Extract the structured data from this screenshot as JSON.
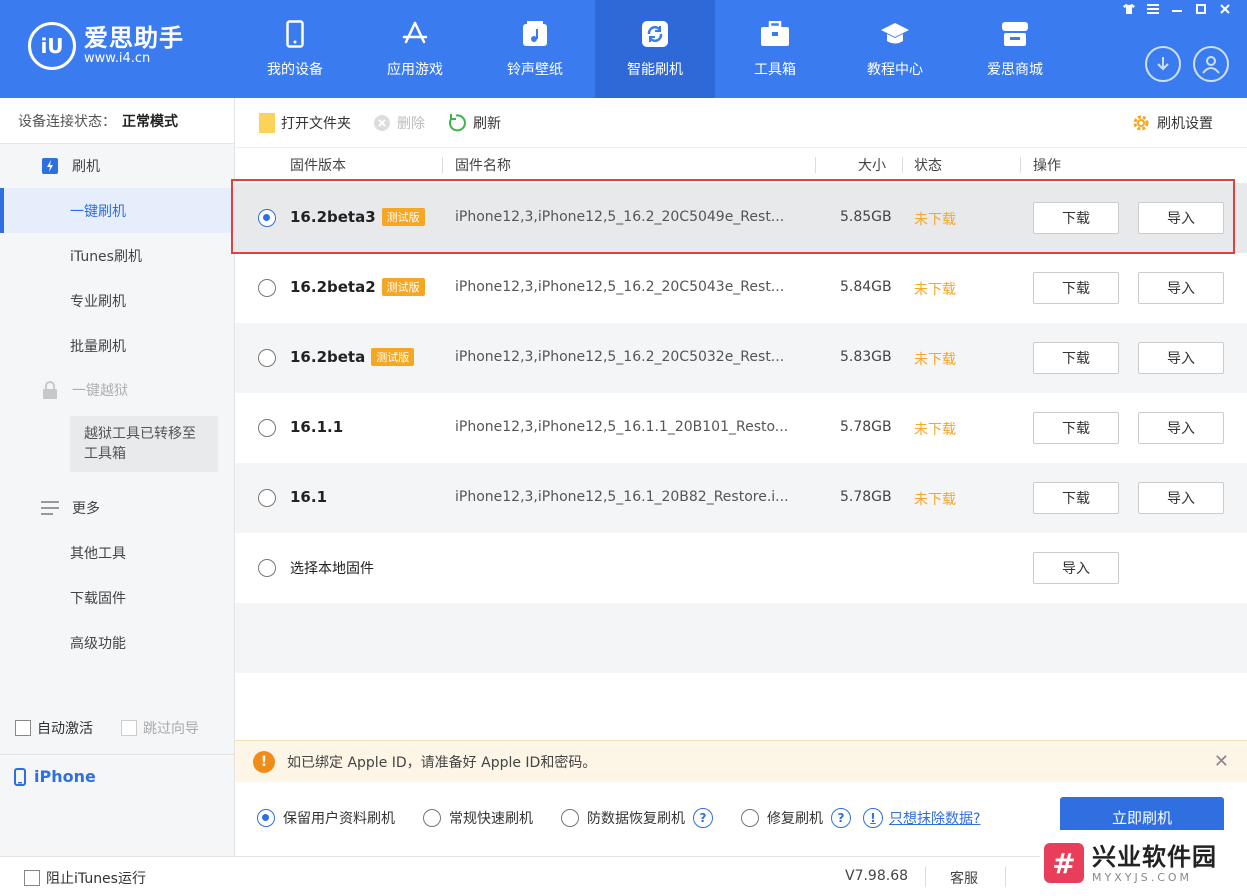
{
  "header": {
    "logo_glyph": "iU",
    "logo_title": "爱思助手",
    "logo_url": "www.i4.cn",
    "nav": [
      {
        "label": "我的设备",
        "icon": "phone-icon"
      },
      {
        "label": "应用游戏",
        "icon": "app-store-icon"
      },
      {
        "label": "铃声壁纸",
        "icon": "music-icon"
      },
      {
        "label": "智能刷机",
        "icon": "refresh-icon"
      },
      {
        "label": "工具箱",
        "icon": "toolbox-icon"
      },
      {
        "label": "教程中心",
        "icon": "graduation-cap-icon"
      },
      {
        "label": "爱思商城",
        "icon": "store-icon"
      }
    ],
    "active_nav": "智能刷机"
  },
  "sidebar": {
    "conn_label": "设备连接状态：",
    "conn_value": "正常模式",
    "flash_group": "刷机",
    "flash_items": [
      "一键刷机",
      "iTunes刷机",
      "专业刷机",
      "批量刷机"
    ],
    "jailbreak_group": "一键越狱",
    "jailbreak_note": "越狱工具已转移至工具箱",
    "more_group": "更多",
    "more_items": [
      "其他工具",
      "下载固件",
      "高级功能"
    ],
    "auto_activate": "自动激活",
    "skip_guide": "跳过向导",
    "device_name": "iPhone"
  },
  "toolbar": {
    "open_folder": "打开文件夹",
    "delete": "删除",
    "refresh": "刷新",
    "settings": "刷机设置"
  },
  "table": {
    "headers": {
      "version": "固件版本",
      "name": "固件名称",
      "size": "大小",
      "status": "状态",
      "ops": "操作"
    },
    "rows": [
      {
        "version": "16.2beta3",
        "badge": "测试版",
        "name": "iPhone12,3,iPhone12,5_16.2_20C5049e_Rest...",
        "size": "5.85GB",
        "status": "未下载",
        "download": "下载",
        "import": "导入"
      },
      {
        "version": "16.2beta2",
        "badge": "测试版",
        "name": "iPhone12,3,iPhone12,5_16.2_20C5043e_Rest...",
        "size": "5.84GB",
        "status": "未下载",
        "download": "下载",
        "import": "导入"
      },
      {
        "version": "16.2beta",
        "badge": "测试版",
        "name": "iPhone12,3,iPhone12,5_16.2_20C5032e_Rest...",
        "size": "5.83GB",
        "status": "未下载",
        "download": "下载",
        "import": "导入"
      },
      {
        "version": "16.1.1",
        "badge": "",
        "name": "iPhone12,3,iPhone12,5_16.1.1_20B101_Resto...",
        "size": "5.78GB",
        "status": "未下载",
        "download": "下载",
        "import": "导入"
      },
      {
        "version": "16.1",
        "badge": "",
        "name": "iPhone12,3,iPhone12,5_16.1_20B82_Restore.i...",
        "size": "5.78GB",
        "status": "未下载",
        "download": "下载",
        "import": "导入"
      }
    ],
    "local_label": "选择本地固件",
    "local_import": "导入"
  },
  "notice": {
    "text": "如已绑定 Apple ID，请准备好 Apple ID和密码。"
  },
  "options": {
    "items": [
      "保留用户资料刷机",
      "常规快速刷机",
      "防数据恢复刷机",
      "修复刷机"
    ],
    "help_glyph": "?",
    "info_glyph": "!",
    "erase_link": "只想抹除数据?",
    "flash_button": "立即刷机"
  },
  "statusbar": {
    "block_itunes": "阻止iTunes运行",
    "version": "V7.98.68",
    "service": "客服"
  },
  "watermark": {
    "logo_glyph": "#",
    "title": "兴业软件园",
    "url": "MYXYJS.COM"
  },
  "colors": {
    "header_bg": "#3a7cf0",
    "accent": "#2f6fe0",
    "warning": "#f5a623",
    "highlight_border": "#e04040"
  }
}
